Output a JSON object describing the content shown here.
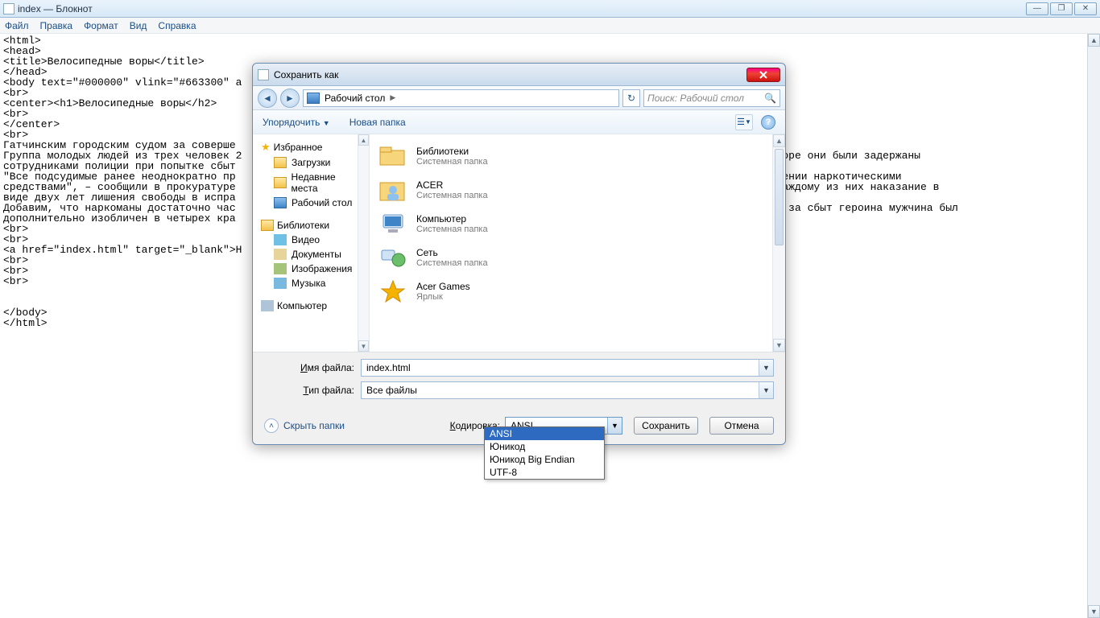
{
  "notepad": {
    "title": "index — Блокнот",
    "menus": [
      "Файл",
      "Правка",
      "Формат",
      "Вид",
      "Справка"
    ],
    "content": "<html>\n<head>\n<title>Велосипедные воры</title>\n</head>\n<body text=\"#000000\" vlink=\"#663300\" a\n<br>\n<center><h1>Велосипедные воры</h2>\n<br>\n</center>\n<br>\nГатчинским городским судом за соверше                                                                       и.\nГруппа молодых людей из трех человек 2                                                                       \"Аэродром\". Вскоре они были задержаны\nсотрудниками полиции при попытке сбыт                                                                        евшему.\n\"Все подсудимые ранее неоднократно пр                                                                        ы в злоупотреблении наркотическими\nсредствами\", – сообщили в прокуратуре                                                                        суд определил каждому из них наказание в\nвиде двух лет лишения свободы в испра\nДобавим, что наркоманы достаточно час                                                                        ице задержанный за сбыт героина мужчина был\nдополнительно изобличен в четырех кра                                                                        имый мужчина.\n<br>\n<br>\n<a href=\"index.html\" target=\"_blank\">Н\n<br>\n<br>\n<br>\n\n\n</body>\n</html>"
  },
  "dialog": {
    "title": "Сохранить как",
    "breadcrumb": "Рабочий стол",
    "search_placeholder": "Поиск: Рабочий стол",
    "toolbar": {
      "organize": "Упорядочить",
      "newfolder": "Новая папка"
    },
    "sidebar": {
      "favorites": "Избранное",
      "fav_items": [
        "Загрузки",
        "Недавние места",
        "Рабочий стол"
      ],
      "libraries": "Библиотеки",
      "lib_items": [
        "Видео",
        "Документы",
        "Изображения",
        "Музыка"
      ],
      "computer": "Компьютер"
    },
    "files": [
      {
        "name": "Библиотеки",
        "sub": "Системная папка",
        "icon": "libraries"
      },
      {
        "name": "ACER",
        "sub": "Системная папка",
        "icon": "user"
      },
      {
        "name": "Компьютер",
        "sub": "Системная папка",
        "icon": "computer"
      },
      {
        "name": "Сеть",
        "sub": "Системная папка",
        "icon": "network"
      },
      {
        "name": "Acer Games",
        "sub": "Ярлык",
        "icon": "shortcut"
      }
    ],
    "filename_label": "Имя файла:",
    "filename_value": "index.html",
    "filetype_label": "Тип файла:",
    "filetype_value": "Все файлы",
    "hide_folders": "Скрыть папки",
    "encoding_label": "Кодировка:",
    "encoding_value": "ANSI",
    "encoding_options": [
      "ANSI",
      "Юникод",
      "Юникод Big Endian",
      "UTF-8"
    ],
    "save": "Сохранить",
    "cancel": "Отмена"
  }
}
